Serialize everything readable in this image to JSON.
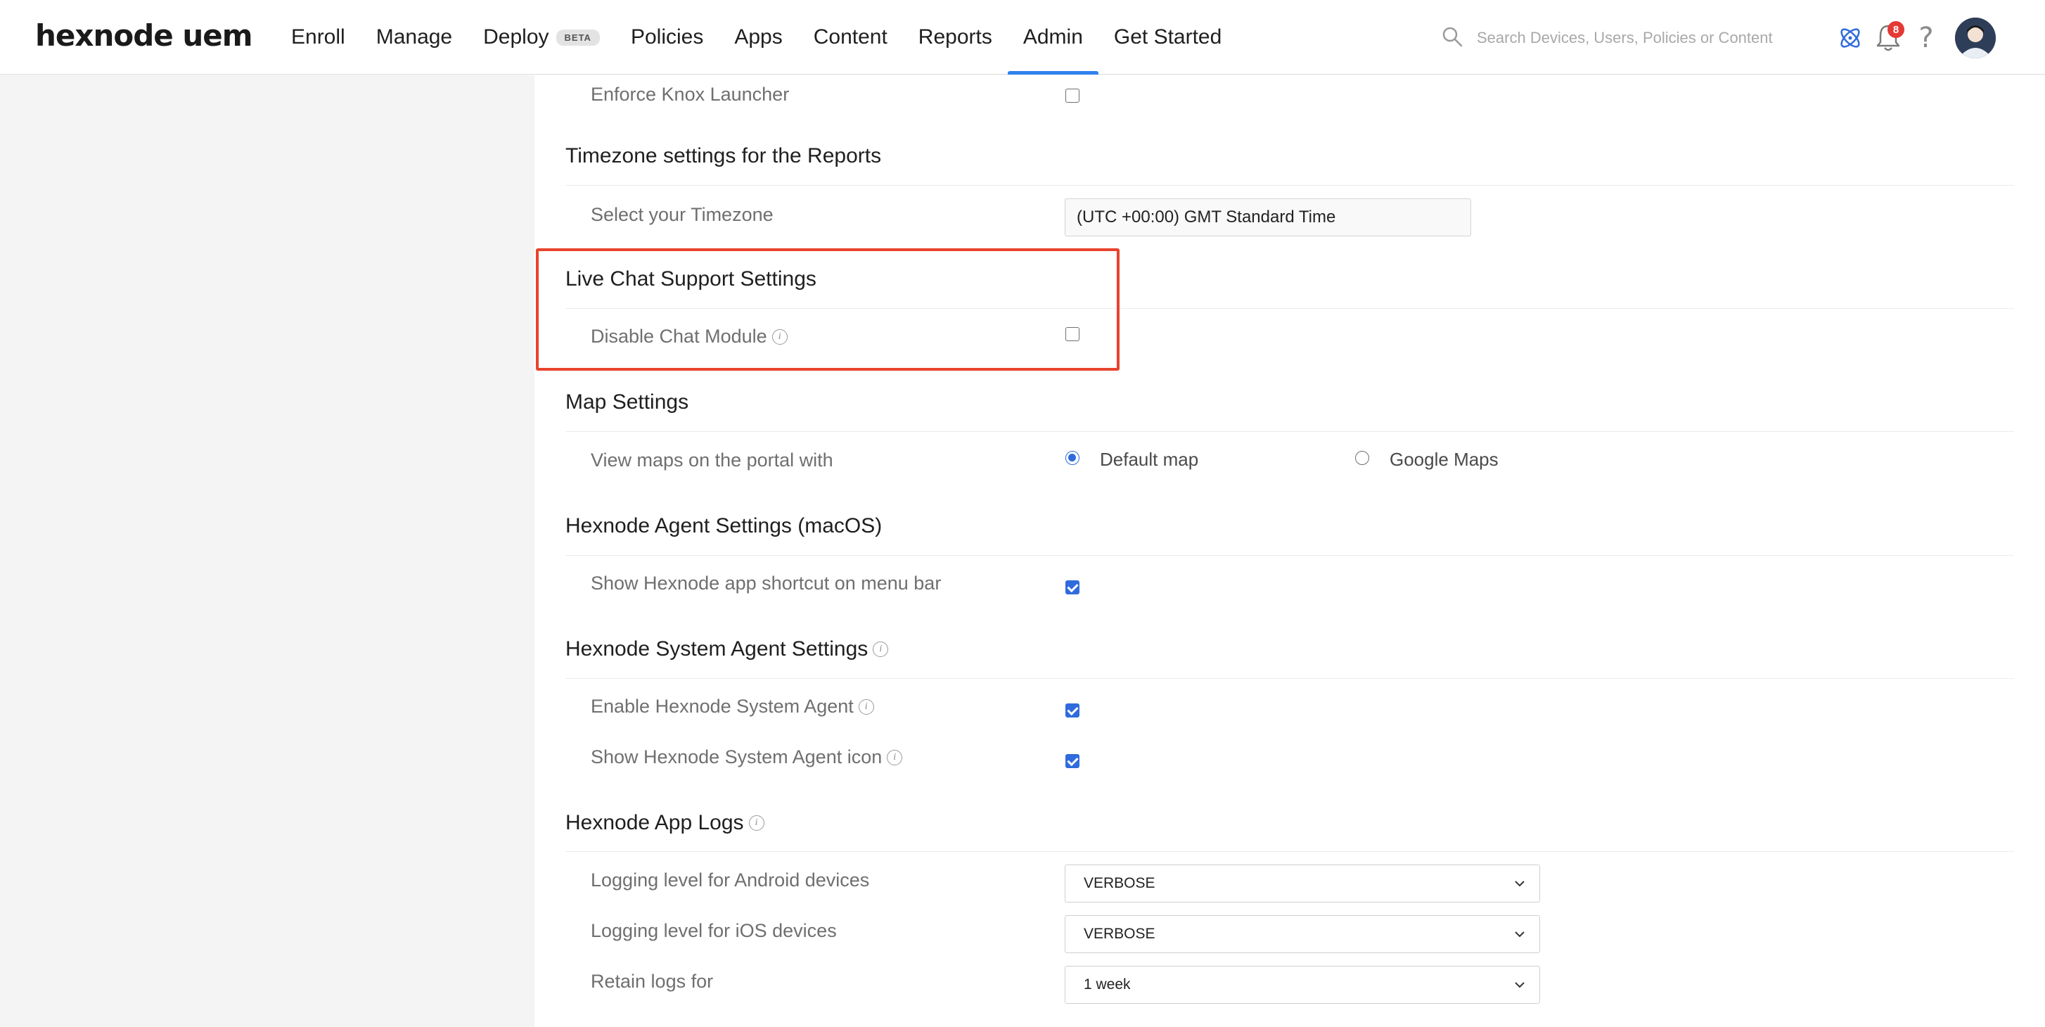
{
  "logo": "hexnode uem",
  "nav": {
    "items": [
      "Enroll",
      "Manage",
      "Deploy",
      "Policies",
      "Apps",
      "Content",
      "Reports",
      "Admin",
      "Get Started"
    ],
    "beta_label": "BETA",
    "active": "Admin"
  },
  "search": {
    "placeholder": "Search Devices, Users, Policies or Content"
  },
  "notifications": {
    "count": "8"
  },
  "help_glyph": "?",
  "colors": {
    "accent": "#2f80ed",
    "checkbox": "#2f6bdc",
    "highlight": "#e8432d",
    "badge": "#e53935"
  },
  "icons": [
    "search-icon",
    "hexnode-atom-icon",
    "bell-icon",
    "help-icon",
    "avatar",
    "info-icon",
    "chevron-down-icon"
  ],
  "settings": {
    "knox": {
      "label": "Enforce Knox Launcher",
      "checked": false
    },
    "timezone": {
      "title": "Timezone settings for the Reports",
      "label": "Select your Timezone",
      "value": "(UTC +00:00) GMT Standard Time"
    },
    "livechat": {
      "title": "Live Chat Support Settings",
      "label": "Disable Chat Module",
      "checked": false
    },
    "map": {
      "title": "Map Settings",
      "label": "View maps on the portal with",
      "options": [
        "Default map",
        "Google Maps"
      ],
      "selected": "Default map"
    },
    "agent_macos": {
      "title": "Hexnode Agent Settings (macOS)",
      "label": "Show Hexnode app shortcut on menu bar",
      "checked": true
    },
    "system_agent": {
      "title": "Hexnode System Agent Settings",
      "enable_label": "Enable Hexnode System Agent",
      "enable_checked": true,
      "icon_label": "Show Hexnode System Agent icon",
      "icon_checked": true
    },
    "app_logs": {
      "title": "Hexnode App Logs",
      "android_label": "Logging level for Android devices",
      "android_value": "VERBOSE",
      "ios_label": "Logging level for iOS devices",
      "ios_value": "VERBOSE",
      "retain_label": "Retain logs for",
      "retain_value": "1 week"
    }
  }
}
